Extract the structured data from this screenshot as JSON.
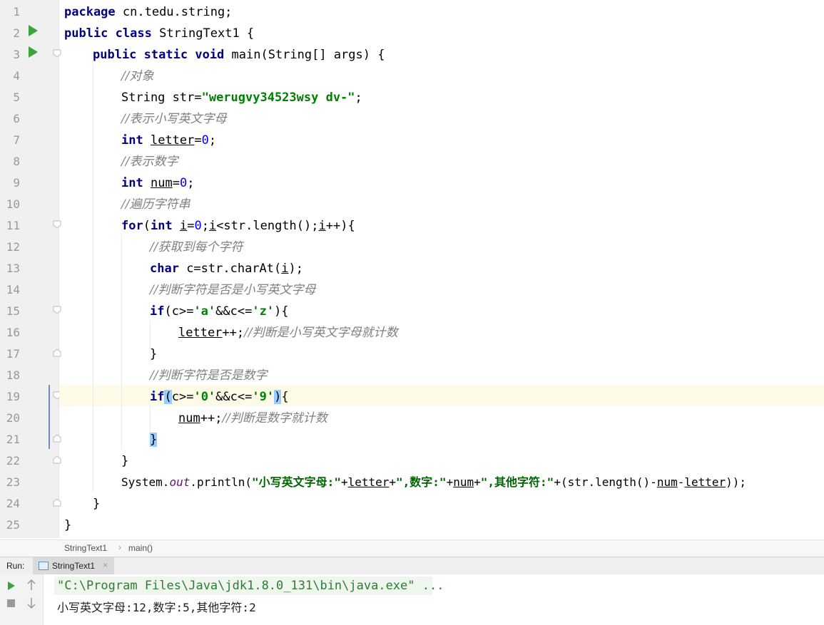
{
  "editor": {
    "line_numbers": [
      "1",
      "2",
      "3",
      "4",
      "5",
      "6",
      "7",
      "8",
      "9",
      "10",
      "11",
      "12",
      "13",
      "14",
      "15",
      "16",
      "17",
      "18",
      "19",
      "20",
      "21",
      "22",
      "23",
      "24",
      "25"
    ],
    "code": {
      "l1_kw": "package",
      "l1_rest": " cn.tedu.string;",
      "l2_kw1": "public",
      "l2_kw2": "class",
      "l2_rest": " StringText1 {",
      "l3_kw1": "public",
      "l3_kw2": "static",
      "l3_kw3": "void",
      "l3_rest": " main(String[] args) {",
      "l4_cm": "//对象",
      "l5_a": "String str=",
      "l5_str": "\"werugvy34523wsy dv-\"",
      "l5_b": ";",
      "l6_cm": "//表示小写英文字母",
      "l7_kw": "int",
      "l7_var": "letter",
      "l7_eq": "=",
      "l7_num": "0",
      "l7_end": ";",
      "l8_cm": "//表示数字",
      "l9_kw": "int",
      "l9_var": "num",
      "l9_eq": "=",
      "l9_num": "0",
      "l9_end": ";",
      "l10_cm": "//遍历字符串",
      "l11_kw1": "for",
      "l11_p": "(",
      "l11_kw2": "int",
      "l11_i1": "i",
      "l11_eq": "=",
      "l11_n0": "0",
      "l11_s": ";",
      "l11_i2": "i",
      "l11_mid": "<str.length();",
      "l11_i3": "i",
      "l11_end": "++){",
      "l12_cm": "//获取到每个字符",
      "l13_kw": "char",
      "l13_a": " c=str.charAt(",
      "l13_i": "i",
      "l13_b": ");",
      "l14_cm": "//判断字符是否是小写英文字母",
      "l15_kw": "if",
      "l15_a": "(c>=",
      "l15_c1": "'a'",
      "l15_b": "&&c<=",
      "l15_c2": "'z'",
      "l15_c": "){",
      "l16_var": "letter",
      "l16_a": "++;",
      "l16_cm": "//判断是小写英文字母就计数",
      "l17": "}",
      "l18_cm": "//判断字符是否是数字",
      "l19_kw": "if",
      "l19_p1": "(",
      "l19_a": "c>=",
      "l19_c1": "'0'",
      "l19_b": "&&c<=",
      "l19_c2": "'9'",
      "l19_p2": ")",
      "l19_c": "{",
      "l20_var": "num",
      "l20_a": "++;",
      "l20_cm": "//判断是数字就计数",
      "l21": "}",
      "l22": "}",
      "l23_a": "System.",
      "l23_out": "out",
      "l23_b": ".println(",
      "l23_s1": "\"小写英文字母:\"",
      "l23_p1": "+",
      "l23_v1": "letter",
      "l23_p2": "+",
      "l23_s2": "\",数字:\"",
      "l23_p3": "+",
      "l23_v2": "num",
      "l23_p4": "+",
      "l23_s3": "\",其他字符:\"",
      "l23_c": "+(str.length()-",
      "l23_v3": "num",
      "l23_d": "-",
      "l23_v4": "letter",
      "l23_e": "));",
      "l24": "}",
      "l25": "}"
    }
  },
  "breadcrumb": {
    "class": "StringText1",
    "sep": "›",
    "method": "main()"
  },
  "run_panel": {
    "label": "Run:",
    "tab": "StringText1",
    "close": "×",
    "output_cmd": "\"C:\\Program Files\\Java\\jdk1.8.0_131\\bin\\java.exe\" ...",
    "output_result": "小写英文字母:12,数字:5,其他字符:2"
  },
  "colors": {
    "keyword": "#000080",
    "comment": "#808080",
    "string": "#008000",
    "number": "#0000ff",
    "run_green": "#3aa33a",
    "current_line": "#fdfbe8",
    "brace_match": "#99ccff"
  }
}
